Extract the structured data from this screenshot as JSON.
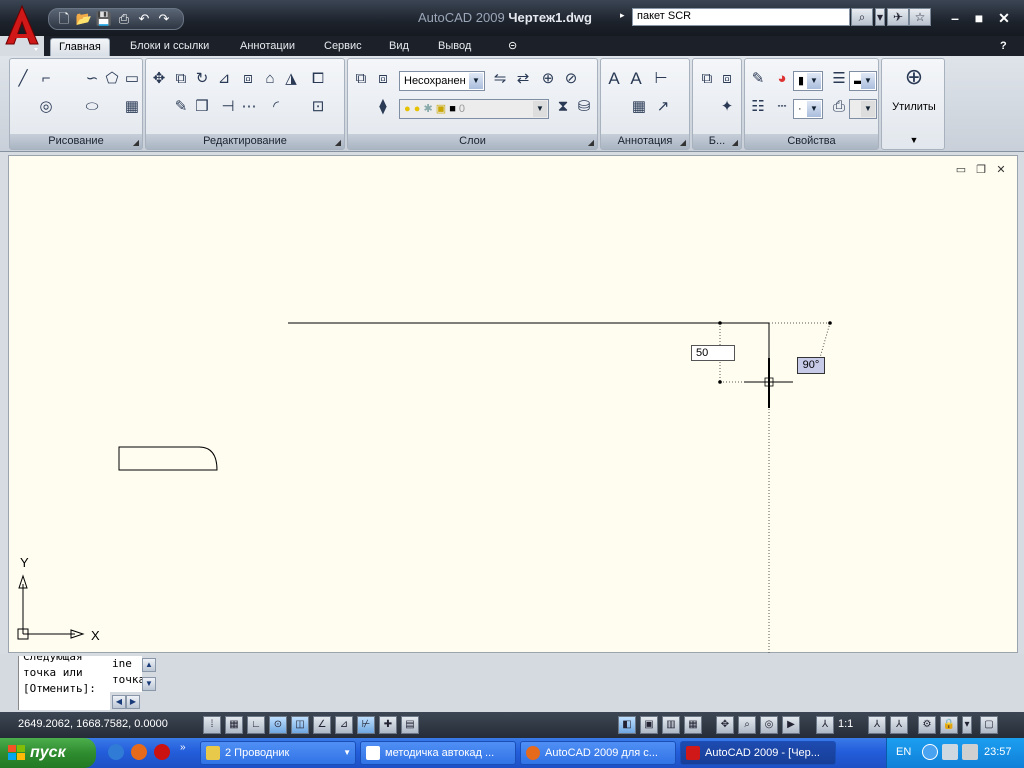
{
  "window": {
    "app_name": "AutoCAD 2009",
    "document": "Чертеж1.dwg",
    "search_value": "пакет SCR"
  },
  "ribbon": {
    "tabs": [
      "Главная",
      "Блоки и ссылки",
      "Аннотации",
      "Сервис",
      "Вид",
      "Вывод"
    ],
    "panels": {
      "draw": "Рисование",
      "modify": "Редактирование",
      "layers": "Слои",
      "annotation": "Аннотация",
      "blocks": "Б...",
      "properties": "Свойства",
      "utilities": "Утилиты"
    },
    "layer_state": "Несохранен",
    "current_layer": "0"
  },
  "drawing": {
    "dynamic_input_value": "50",
    "angle_tooltip": "90°",
    "ucs_x_label": "X",
    "ucs_y_label": "Y"
  },
  "command_line": {
    "lines": [
      "Следующая",
      "точка или",
      "[Отменить]:"
    ],
    "right_lines": [
      "ine",
      "точка"
    ]
  },
  "status": {
    "coordinates": "2649.2062, 1668.7582, 0.0000",
    "annotation_scale": "1:1"
  },
  "taskbar": {
    "start": "пуск",
    "tasks": [
      "2 Проводник",
      "методичка автокад ...",
      "AutoCAD 2009 для с...",
      "AutoCAD 2009 - [Чер..."
    ],
    "language": "EN",
    "clock": "23:57"
  },
  "colors": {
    "canvas": "#fffdf0",
    "taskbar": "#245edb",
    "start": "#2f8c2f",
    "angle_tooltip": "#c8cbe8"
  }
}
